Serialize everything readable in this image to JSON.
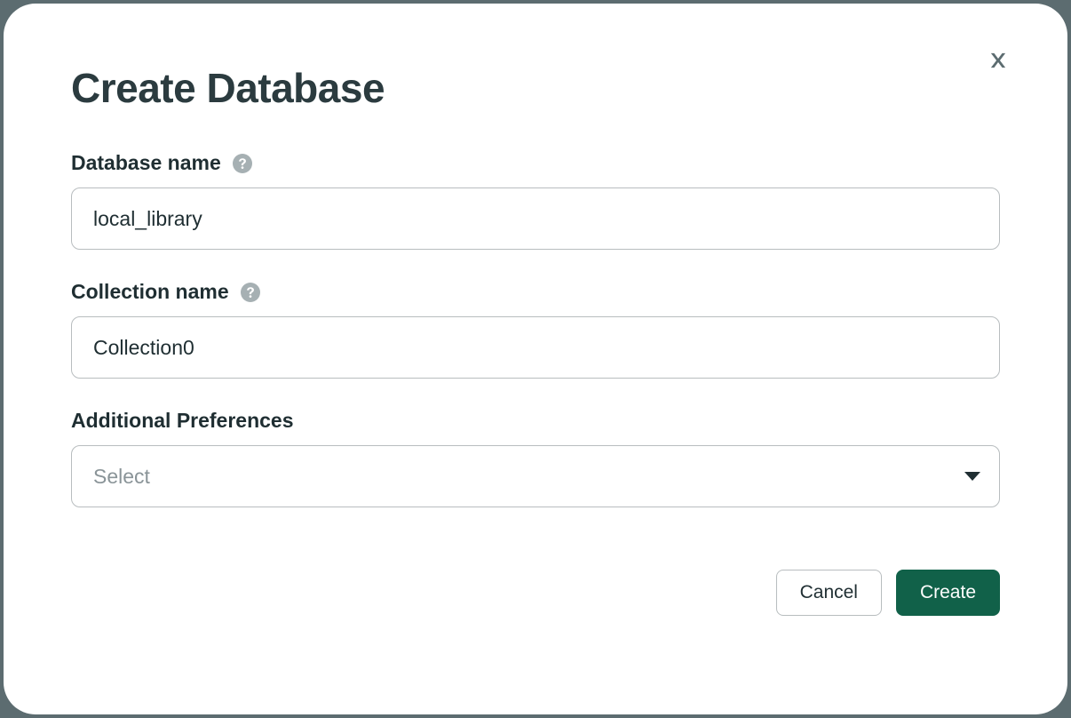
{
  "modal": {
    "title": "Create Database",
    "fields": {
      "database_name": {
        "label": "Database name",
        "value": "local_library"
      },
      "collection_name": {
        "label": "Collection name",
        "value": "Collection0"
      },
      "additional_preferences": {
        "label": "Additional Preferences",
        "placeholder": "Select"
      }
    },
    "buttons": {
      "cancel": "Cancel",
      "create": "Create"
    }
  }
}
